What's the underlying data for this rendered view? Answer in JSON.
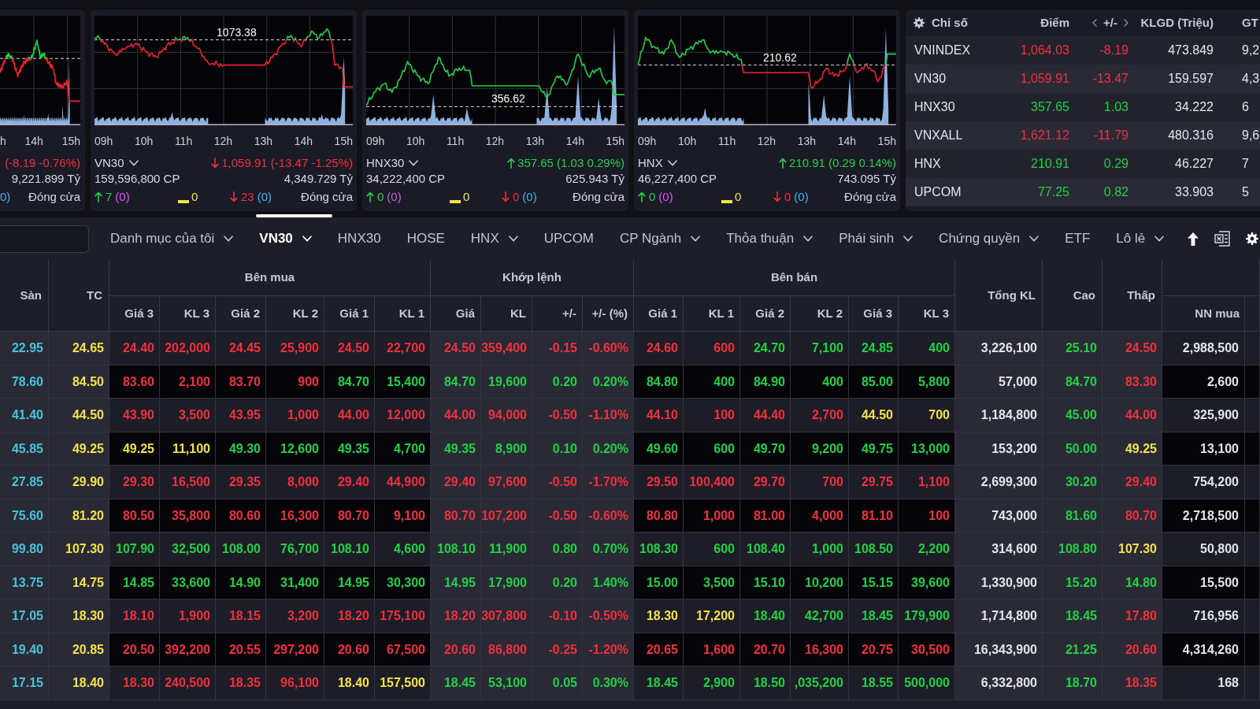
{
  "charts": [
    {
      "kind": "clipped",
      "x_labels": [
        "h",
        "14h",
        "15h"
      ],
      "rising": false,
      "change": "(-8.19 -0.76%)",
      "value": "9,221.899 Tỷ",
      "floor_count": "0)",
      "session": "Đóng cửa"
    },
    {
      "kind": "full",
      "index_name": "VN30",
      "reference_label": "1073.38",
      "x_labels": [
        "09h",
        "10h",
        "11h",
        "12h",
        "13h",
        "14h",
        "15h"
      ],
      "rising": false,
      "change": "1,059.91 (-13.47 -1.25%)",
      "volume": "159,596,800 CP",
      "value": "4,349.729 Tỷ",
      "advances": "7",
      "ceiling_count": "(0)",
      "unchanged": "0",
      "declines": "23",
      "floor_count": "(0)",
      "session": "Đóng cửa"
    },
    {
      "kind": "full",
      "index_name": "HNX30",
      "reference_label": "356.62",
      "x_labels": [
        "09h",
        "10h",
        "11h",
        "12h",
        "13h",
        "14h",
        "15h"
      ],
      "rising": true,
      "change": "357.65 (1.03 0.29%)",
      "volume": "34,222,400 CP",
      "value": "625.943 Tỷ",
      "advances": "0",
      "ceiling_count": "(0)",
      "unchanged": "0",
      "declines": "0",
      "floor_count": "(0)",
      "session": "Đóng cửa"
    },
    {
      "kind": "full",
      "index_name": "HNX",
      "reference_label": "210.62",
      "x_labels": [
        "09h",
        "10h",
        "11h",
        "12h",
        "13h",
        "14h",
        "15h"
      ],
      "rising": true,
      "change": "210.91 (0.29 0.14%)",
      "volume": "46,227,400 CP",
      "value": "743.095 Tỷ",
      "advances": "0",
      "ceiling_count": "(0)",
      "unchanged": "0",
      "declines": "0",
      "floor_count": "(0)",
      "session": "Đóng cửa"
    }
  ],
  "index_table": {
    "columns": [
      {
        "label": "Chỉ số",
        "kind": "name"
      },
      {
        "label": "Điểm",
        "kind": "number"
      },
      {
        "label": "+/-",
        "kind": "switchable"
      },
      {
        "label": "KLGD (Triệu)",
        "kind": "number"
      },
      {
        "label": "GT",
        "kind": "clipped"
      }
    ],
    "rows": [
      {
        "name": "VNINDEX",
        "points": "1,064.03",
        "change": "-8.19",
        "volume": "473.849",
        "value": "9,2",
        "rising": false
      },
      {
        "name": "VN30",
        "points": "1,059.91",
        "change": "-13.47",
        "volume": "159.597",
        "value": "4,3",
        "rising": false
      },
      {
        "name": "HNX30",
        "points": "357.65",
        "change": "1.03",
        "volume": "34.222",
        "value": "6",
        "rising": true
      },
      {
        "name": "VNXALL",
        "points": "1,621.12",
        "change": "-11.79",
        "volume": "480.316",
        "value": "9,6",
        "rising": false
      },
      {
        "name": "HNX",
        "points": "210.91",
        "change": "0.29",
        "volume": "46.227",
        "value": "7",
        "rising": true
      },
      {
        "name": "UPCOM",
        "points": "77.25",
        "change": "0.82",
        "volume": "33.903",
        "value": "5",
        "rising": true
      }
    ]
  },
  "tabs": [
    {
      "label": "Danh mục của tôi",
      "selected": false,
      "dropdown": true
    },
    {
      "label": "VN30",
      "selected": true,
      "dropdown": true
    },
    {
      "label": "HNX30",
      "selected": false,
      "dropdown": false
    },
    {
      "label": "HOSE",
      "selected": false,
      "dropdown": false
    },
    {
      "label": "HNX",
      "selected": false,
      "dropdown": true
    },
    {
      "label": "UPCOM",
      "selected": false,
      "dropdown": false
    },
    {
      "label": "CP Ngành",
      "selected": false,
      "dropdown": true
    },
    {
      "label": "Thỏa thuận",
      "selected": false,
      "dropdown": true
    },
    {
      "label": "Phái sinh",
      "selected": false,
      "dropdown": true
    },
    {
      "label": "Chứng quyền",
      "selected": false,
      "dropdown": true
    },
    {
      "label": "ETF",
      "selected": false,
      "dropdown": false
    },
    {
      "label": "Lô lẻ",
      "selected": false,
      "dropdown": true
    }
  ],
  "board": {
    "columns": [
      {
        "label": "Sàn",
        "in_group": false
      },
      {
        "label": "TC",
        "in_group": false
      },
      {
        "label": "Giá 3",
        "in_group": true,
        "group_label": "Bên mua"
      },
      {
        "label": "KL 3",
        "in_group": true
      },
      {
        "label": "Giá 2",
        "in_group": true
      },
      {
        "label": "KL 2",
        "in_group": true
      },
      {
        "label": "Giá 1",
        "in_group": true
      },
      {
        "label": "KL 1",
        "in_group": true
      },
      {
        "label": "Giá",
        "in_group": true,
        "group_label": "Khớp lệnh"
      },
      {
        "label": "KL",
        "in_group": true
      },
      {
        "label": "+/-",
        "in_group": true
      },
      {
        "label": "+/- (%)",
        "in_group": true
      },
      {
        "label": "Giá 1",
        "in_group": true,
        "group_label": "Bên bán"
      },
      {
        "label": "KL 1",
        "in_group": true
      },
      {
        "label": "Giá 2",
        "in_group": true
      },
      {
        "label": "KL 2",
        "in_group": true
      },
      {
        "label": "Giá 3",
        "in_group": true
      },
      {
        "label": "KL 3",
        "in_group": true
      },
      {
        "label": "Tổng KL",
        "in_group": false
      },
      {
        "label": "Cao",
        "in_group": false
      },
      {
        "label": "Thấp",
        "in_group": false
      },
      {
        "label": "NN mua",
        "in_group": true
      }
    ],
    "rows": [
      {
        "cells": [
          {
            "text": "22.95",
            "kind": "floor"
          },
          {
            "text": "24.65",
            "kind": "ref"
          },
          {
            "text": "24.40",
            "kind": "down"
          },
          {
            "text": "202,000",
            "kind": "down"
          },
          {
            "text": "24.45",
            "kind": "down"
          },
          {
            "text": "25,900",
            "kind": "down"
          },
          {
            "text": "24.50",
            "kind": "down"
          },
          {
            "text": "22,700",
            "kind": "down"
          },
          {
            "text": "24.50",
            "kind": "down"
          },
          {
            "text": "359,400",
            "kind": "down"
          },
          {
            "text": "-0.15",
            "kind": "down"
          },
          {
            "text": "-0.60%",
            "kind": "down"
          },
          {
            "text": "24.60",
            "kind": "down"
          },
          {
            "text": "600",
            "kind": "down"
          },
          {
            "text": "24.70",
            "kind": "up"
          },
          {
            "text": "7,100",
            "kind": "up"
          },
          {
            "text": "24.85",
            "kind": "up"
          },
          {
            "text": "400",
            "kind": "up"
          },
          {
            "text": "3,226,100",
            "kind": "plain"
          },
          {
            "text": "25.10",
            "kind": "up"
          },
          {
            "text": "24.50",
            "kind": "down"
          },
          {
            "text": "2,988,500",
            "kind": "plain"
          }
        ]
      },
      {
        "cells": [
          {
            "text": "78.60",
            "kind": "floor"
          },
          {
            "text": "84.50",
            "kind": "ref"
          },
          {
            "text": "83.60",
            "kind": "down"
          },
          {
            "text": "2,100",
            "kind": "down"
          },
          {
            "text": "83.70",
            "kind": "down"
          },
          {
            "text": "900",
            "kind": "down"
          },
          {
            "text": "84.70",
            "kind": "up"
          },
          {
            "text": "15,400",
            "kind": "up"
          },
          {
            "text": "84.70",
            "kind": "up"
          },
          {
            "text": "19,600",
            "kind": "up"
          },
          {
            "text": "0.20",
            "kind": "up"
          },
          {
            "text": "0.20%",
            "kind": "up"
          },
          {
            "text": "84.80",
            "kind": "up"
          },
          {
            "text": "400",
            "kind": "up"
          },
          {
            "text": "84.90",
            "kind": "up"
          },
          {
            "text": "400",
            "kind": "up"
          },
          {
            "text": "85.00",
            "kind": "up"
          },
          {
            "text": "5,800",
            "kind": "up"
          },
          {
            "text": "57,000",
            "kind": "plain"
          },
          {
            "text": "84.70",
            "kind": "up"
          },
          {
            "text": "83.30",
            "kind": "down"
          },
          {
            "text": "2,600",
            "kind": "plain"
          }
        ]
      },
      {
        "cells": [
          {
            "text": "41.40",
            "kind": "floor"
          },
          {
            "text": "44.50",
            "kind": "ref"
          },
          {
            "text": "43.90",
            "kind": "down"
          },
          {
            "text": "3,500",
            "kind": "down"
          },
          {
            "text": "43.95",
            "kind": "down"
          },
          {
            "text": "1,000",
            "kind": "down"
          },
          {
            "text": "44.00",
            "kind": "down"
          },
          {
            "text": "12,000",
            "kind": "down"
          },
          {
            "text": "44.00",
            "kind": "down"
          },
          {
            "text": "94,000",
            "kind": "down"
          },
          {
            "text": "-0.50",
            "kind": "down"
          },
          {
            "text": "-1.10%",
            "kind": "down"
          },
          {
            "text": "44.10",
            "kind": "down"
          },
          {
            "text": "100",
            "kind": "down"
          },
          {
            "text": "44.40",
            "kind": "down"
          },
          {
            "text": "2,700",
            "kind": "down"
          },
          {
            "text": "44.50",
            "kind": "ref"
          },
          {
            "text": "700",
            "kind": "ref"
          },
          {
            "text": "1,184,800",
            "kind": "plain"
          },
          {
            "text": "45.00",
            "kind": "up"
          },
          {
            "text": "44.00",
            "kind": "down"
          },
          {
            "text": "325,900",
            "kind": "plain"
          }
        ]
      },
      {
        "cells": [
          {
            "text": "45.85",
            "kind": "floor"
          },
          {
            "text": "49.25",
            "kind": "ref"
          },
          {
            "text": "49.25",
            "kind": "ref"
          },
          {
            "text": "11,100",
            "kind": "ref"
          },
          {
            "text": "49.30",
            "kind": "up"
          },
          {
            "text": "12,600",
            "kind": "up"
          },
          {
            "text": "49.35",
            "kind": "up"
          },
          {
            "text": "4,700",
            "kind": "up"
          },
          {
            "text": "49.35",
            "kind": "up"
          },
          {
            "text": "8,900",
            "kind": "up"
          },
          {
            "text": "0.10",
            "kind": "up"
          },
          {
            "text": "0.20%",
            "kind": "up"
          },
          {
            "text": "49.60",
            "kind": "up"
          },
          {
            "text": "600",
            "kind": "up"
          },
          {
            "text": "49.70",
            "kind": "up"
          },
          {
            "text": "9,200",
            "kind": "up"
          },
          {
            "text": "49.75",
            "kind": "up"
          },
          {
            "text": "13,000",
            "kind": "up"
          },
          {
            "text": "153,200",
            "kind": "plain"
          },
          {
            "text": "50.00",
            "kind": "up"
          },
          {
            "text": "49.25",
            "kind": "ref"
          },
          {
            "text": "13,100",
            "kind": "plain"
          }
        ]
      },
      {
        "cells": [
          {
            "text": "27.85",
            "kind": "floor"
          },
          {
            "text": "29.90",
            "kind": "ref"
          },
          {
            "text": "29.30",
            "kind": "down"
          },
          {
            "text": "16,500",
            "kind": "down"
          },
          {
            "text": "29.35",
            "kind": "down"
          },
          {
            "text": "8,000",
            "kind": "down"
          },
          {
            "text": "29.40",
            "kind": "down"
          },
          {
            "text": "44,900",
            "kind": "down"
          },
          {
            "text": "29.40",
            "kind": "down"
          },
          {
            "text": "97,600",
            "kind": "down"
          },
          {
            "text": "-0.50",
            "kind": "down"
          },
          {
            "text": "-1.70%",
            "kind": "down"
          },
          {
            "text": "29.50",
            "kind": "down"
          },
          {
            "text": "100,400",
            "kind": "down"
          },
          {
            "text": "29.70",
            "kind": "down"
          },
          {
            "text": "700",
            "kind": "down"
          },
          {
            "text": "29.75",
            "kind": "down"
          },
          {
            "text": "1,100",
            "kind": "down"
          },
          {
            "text": "2,699,300",
            "kind": "plain"
          },
          {
            "text": "30.20",
            "kind": "up"
          },
          {
            "text": "29.40",
            "kind": "down"
          },
          {
            "text": "754,200",
            "kind": "plain"
          }
        ]
      },
      {
        "cells": [
          {
            "text": "75.60",
            "kind": "floor"
          },
          {
            "text": "81.20",
            "kind": "ref"
          },
          {
            "text": "80.50",
            "kind": "down"
          },
          {
            "text": "35,800",
            "kind": "down"
          },
          {
            "text": "80.60",
            "kind": "down"
          },
          {
            "text": "16,300",
            "kind": "down"
          },
          {
            "text": "80.70",
            "kind": "down"
          },
          {
            "text": "9,100",
            "kind": "down"
          },
          {
            "text": "80.70",
            "kind": "down"
          },
          {
            "text": "107,200",
            "kind": "down"
          },
          {
            "text": "-0.50",
            "kind": "down"
          },
          {
            "text": "-0.60%",
            "kind": "down"
          },
          {
            "text": "80.80",
            "kind": "down"
          },
          {
            "text": "1,000",
            "kind": "down"
          },
          {
            "text": "81.00",
            "kind": "down"
          },
          {
            "text": "4,000",
            "kind": "down"
          },
          {
            "text": "81.10",
            "kind": "down"
          },
          {
            "text": "100",
            "kind": "down"
          },
          {
            "text": "743,000",
            "kind": "plain"
          },
          {
            "text": "81.60",
            "kind": "up"
          },
          {
            "text": "80.70",
            "kind": "down"
          },
          {
            "text": "2,718,500",
            "kind": "plain"
          }
        ]
      },
      {
        "cells": [
          {
            "text": "99.80",
            "kind": "floor"
          },
          {
            "text": "107.30",
            "kind": "ref"
          },
          {
            "text": "107.90",
            "kind": "up"
          },
          {
            "text": "32,500",
            "kind": "up"
          },
          {
            "text": "108.00",
            "kind": "up"
          },
          {
            "text": "76,700",
            "kind": "up"
          },
          {
            "text": "108.10",
            "kind": "up"
          },
          {
            "text": "4,600",
            "kind": "up"
          },
          {
            "text": "108.10",
            "kind": "up"
          },
          {
            "text": "11,900",
            "kind": "up"
          },
          {
            "text": "0.80",
            "kind": "up"
          },
          {
            "text": "0.70%",
            "kind": "up"
          },
          {
            "text": "108.30",
            "kind": "up"
          },
          {
            "text": "600",
            "kind": "up"
          },
          {
            "text": "108.40",
            "kind": "up"
          },
          {
            "text": "1,000",
            "kind": "up"
          },
          {
            "text": "108.50",
            "kind": "up"
          },
          {
            "text": "2,200",
            "kind": "up"
          },
          {
            "text": "314,600",
            "kind": "plain"
          },
          {
            "text": "108.80",
            "kind": "up"
          },
          {
            "text": "107.30",
            "kind": "ref"
          },
          {
            "text": "50,800",
            "kind": "plain"
          }
        ]
      },
      {
        "cells": [
          {
            "text": "13.75",
            "kind": "floor"
          },
          {
            "text": "14.75",
            "kind": "ref"
          },
          {
            "text": "14.85",
            "kind": "up"
          },
          {
            "text": "33,600",
            "kind": "up"
          },
          {
            "text": "14.90",
            "kind": "up"
          },
          {
            "text": "31,400",
            "kind": "up"
          },
          {
            "text": "14.95",
            "kind": "up"
          },
          {
            "text": "30,300",
            "kind": "up"
          },
          {
            "text": "14.95",
            "kind": "up"
          },
          {
            "text": "17,900",
            "kind": "up"
          },
          {
            "text": "0.20",
            "kind": "up"
          },
          {
            "text": "1.40%",
            "kind": "up"
          },
          {
            "text": "15.00",
            "kind": "up"
          },
          {
            "text": "3,500",
            "kind": "up"
          },
          {
            "text": "15.10",
            "kind": "up"
          },
          {
            "text": "10,200",
            "kind": "up"
          },
          {
            "text": "15.15",
            "kind": "up"
          },
          {
            "text": "39,600",
            "kind": "up"
          },
          {
            "text": "1,330,900",
            "kind": "plain"
          },
          {
            "text": "15.20",
            "kind": "up"
          },
          {
            "text": "14.80",
            "kind": "up"
          },
          {
            "text": "15,500",
            "kind": "plain"
          }
        ]
      },
      {
        "cells": [
          {
            "text": "17.05",
            "kind": "floor"
          },
          {
            "text": "18.30",
            "kind": "ref"
          },
          {
            "text": "18.10",
            "kind": "down"
          },
          {
            "text": "1,900",
            "kind": "down"
          },
          {
            "text": "18.15",
            "kind": "down"
          },
          {
            "text": "3,200",
            "kind": "down"
          },
          {
            "text": "18.20",
            "kind": "down"
          },
          {
            "text": "175,100",
            "kind": "down"
          },
          {
            "text": "18.20",
            "kind": "down"
          },
          {
            "text": "307,800",
            "kind": "down"
          },
          {
            "text": "-0.10",
            "kind": "down"
          },
          {
            "text": "-0.50%",
            "kind": "down"
          },
          {
            "text": "18.30",
            "kind": "ref"
          },
          {
            "text": "17,200",
            "kind": "ref"
          },
          {
            "text": "18.40",
            "kind": "up"
          },
          {
            "text": "42,700",
            "kind": "up"
          },
          {
            "text": "18.45",
            "kind": "up"
          },
          {
            "text": "179,900",
            "kind": "up"
          },
          {
            "text": "1,714,800",
            "kind": "plain"
          },
          {
            "text": "18.45",
            "kind": "up"
          },
          {
            "text": "17.80",
            "kind": "down"
          },
          {
            "text": "716,956",
            "kind": "plain"
          }
        ]
      },
      {
        "cells": [
          {
            "text": "19.40",
            "kind": "floor"
          },
          {
            "text": "20.85",
            "kind": "ref"
          },
          {
            "text": "20.50",
            "kind": "down"
          },
          {
            "text": "392,200",
            "kind": "down"
          },
          {
            "text": "20.55",
            "kind": "down"
          },
          {
            "text": "297,200",
            "kind": "down"
          },
          {
            "text": "20.60",
            "kind": "down"
          },
          {
            "text": "67,500",
            "kind": "down"
          },
          {
            "text": "20.60",
            "kind": "down"
          },
          {
            "text": "86,800",
            "kind": "down"
          },
          {
            "text": "-0.25",
            "kind": "down"
          },
          {
            "text": "-1.20%",
            "kind": "down"
          },
          {
            "text": "20.65",
            "kind": "down"
          },
          {
            "text": "1,600",
            "kind": "down"
          },
          {
            "text": "20.70",
            "kind": "down"
          },
          {
            "text": "16,300",
            "kind": "down"
          },
          {
            "text": "20.75",
            "kind": "down"
          },
          {
            "text": "30,500",
            "kind": "down"
          },
          {
            "text": "16,343,900",
            "kind": "plain"
          },
          {
            "text": "21.25",
            "kind": "up"
          },
          {
            "text": "20.60",
            "kind": "down"
          },
          {
            "text": "4,314,260",
            "kind": "plain"
          }
        ]
      },
      {
        "cells": [
          {
            "text": "17.15",
            "kind": "floor"
          },
          {
            "text": "18.40",
            "kind": "ref"
          },
          {
            "text": "18.30",
            "kind": "down"
          },
          {
            "text": "240,500",
            "kind": "down"
          },
          {
            "text": "18.35",
            "kind": "down"
          },
          {
            "text": "96,100",
            "kind": "down"
          },
          {
            "text": "18.40",
            "kind": "ref"
          },
          {
            "text": "157,500",
            "kind": "ref"
          },
          {
            "text": "18.45",
            "kind": "up"
          },
          {
            "text": "53,100",
            "kind": "up"
          },
          {
            "text": "0.05",
            "kind": "up"
          },
          {
            "text": "0.30%",
            "kind": "up"
          },
          {
            "text": "18.45",
            "kind": "up"
          },
          {
            "text": "2,900",
            "kind": "up"
          },
          {
            "text": "18.50",
            "kind": "up"
          },
          {
            "text": ",035,200",
            "kind": "up"
          },
          {
            "text": "18.55",
            "kind": "up"
          },
          {
            "text": "500,000",
            "kind": "up"
          },
          {
            "text": "6,332,800",
            "kind": "plain"
          },
          {
            "text": "18.70",
            "kind": "up"
          },
          {
            "text": "18.35",
            "kind": "down"
          },
          {
            "text": "168",
            "kind": "plain"
          }
        ]
      }
    ]
  }
}
